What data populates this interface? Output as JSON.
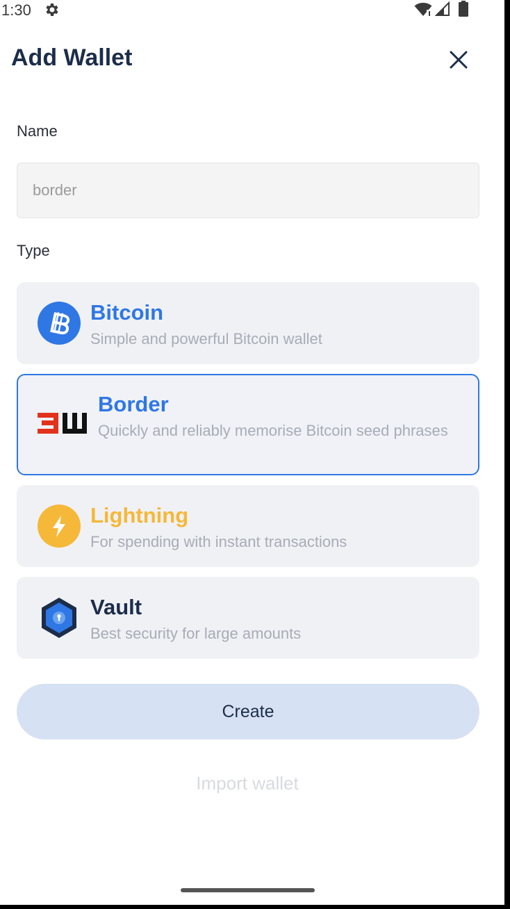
{
  "status_bar": {
    "time": "1:30",
    "icons": [
      "gear-icon",
      "wifi-icon",
      "signal-icon",
      "battery-icon"
    ]
  },
  "header": {
    "title": "Add Wallet",
    "close_icon": "close-icon"
  },
  "form": {
    "name_label": "Name",
    "name_placeholder": "border",
    "name_value": "",
    "type_label": "Type"
  },
  "wallet_types": [
    {
      "title": "Bitcoin",
      "description": "Simple and powerful Bitcoin wallet",
      "icon": "bitcoin-icon",
      "title_color": "#2f77e4",
      "selected": false
    },
    {
      "title": "Border",
      "description": "Quickly and reliably memorise Bitcoin seed phrases",
      "icon": "border-wallet-logo-icon",
      "logo_text": "BW",
      "title_color": "#2f77e4",
      "selected": true
    },
    {
      "title": "Lightning",
      "description": "For spending with instant transactions",
      "icon": "lightning-icon",
      "title_color": "#f5b839",
      "selected": false
    },
    {
      "title": "Vault",
      "description": "Best security for large amounts",
      "icon": "vault-icon",
      "title_color": "#1c2d4a",
      "selected": false
    }
  ],
  "actions": {
    "create_label": "Create",
    "import_label": "Import wallet"
  },
  "colors": {
    "accent": "#2f77e4",
    "title_dark": "#1c2d4a",
    "lightning": "#f5b839",
    "create_bg": "#d7e1f4"
  }
}
